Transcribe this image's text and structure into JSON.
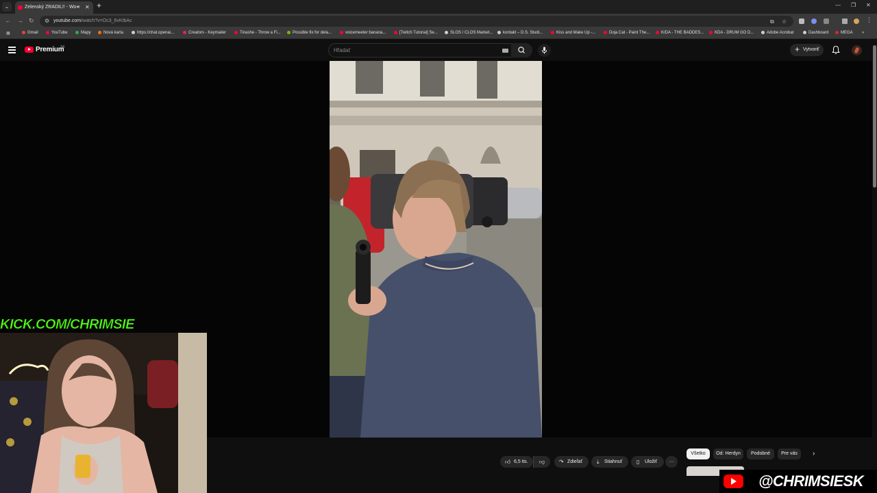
{
  "browser": {
    "tab_title": "Zelenský ZRADIL!! - WoLe",
    "url_domain": "youtube.com",
    "url_path": "/watch?v=Oc3_6vKtbAc",
    "bookmarks": [
      {
        "label": "Gmail",
        "color": "#ea4335"
      },
      {
        "label": "YouTube",
        "color": "#ff0033"
      },
      {
        "label": "Mapy",
        "color": "#34a853"
      },
      {
        "label": "Nová karta",
        "color": "#ff6d00"
      },
      {
        "label": "https://chat.openai...",
        "color": "#cfcfcf"
      },
      {
        "label": "Creators - Keymailer",
        "color": "#e91e63"
      },
      {
        "label": "Tinashe - Throw a Fi...",
        "color": "#ff0033"
      },
      {
        "label": "Possible fix for dela...",
        "color": "#76b900"
      },
      {
        "label": "voicemeeter banana...",
        "color": "#ff0033"
      },
      {
        "label": "[Twitch Tutorial] Se...",
        "color": "#ff0033"
      },
      {
        "label": "SLOS / CLOS Market...",
        "color": "#cfcfcf"
      },
      {
        "label": "kontakt – D.S. Studi...",
        "color": "#cfcfcf"
      },
      {
        "label": "Kiss and Make Up -...",
        "color": "#ff0033"
      },
      {
        "label": "Doja Cat - Paint The...",
        "color": "#ff0033"
      },
      {
        "label": "K/DA - THE BADDES...",
        "color": "#ff0033"
      },
      {
        "label": "KDA - DRUM GO D...",
        "color": "#ff0033"
      },
      {
        "label": "Adobe Acrobat",
        "color": "#cfcfcf"
      },
      {
        "label": "Dashboard",
        "color": "#cfcfcf"
      },
      {
        "label": "MEGA",
        "color": "#d9272e"
      }
    ]
  },
  "youtube": {
    "logo_text": "Premium",
    "country_code": "SK",
    "search_placeholder": "Hľadať",
    "create_label": "Vytvoriť",
    "actions": {
      "likes": "6,5 tis.",
      "share": "Zdieľať",
      "download": "Stiahnuť",
      "save": "Uložiť"
    },
    "chips": [
      "Všetko",
      "Od: Herdyn",
      "Podobné",
      "Pre vás"
    ]
  },
  "overlays": {
    "kick_text": "KICK.COM/CHRIMSIE",
    "youtube_handle": "@CHRIMSIESK",
    "kick_color": "#53fc18"
  }
}
